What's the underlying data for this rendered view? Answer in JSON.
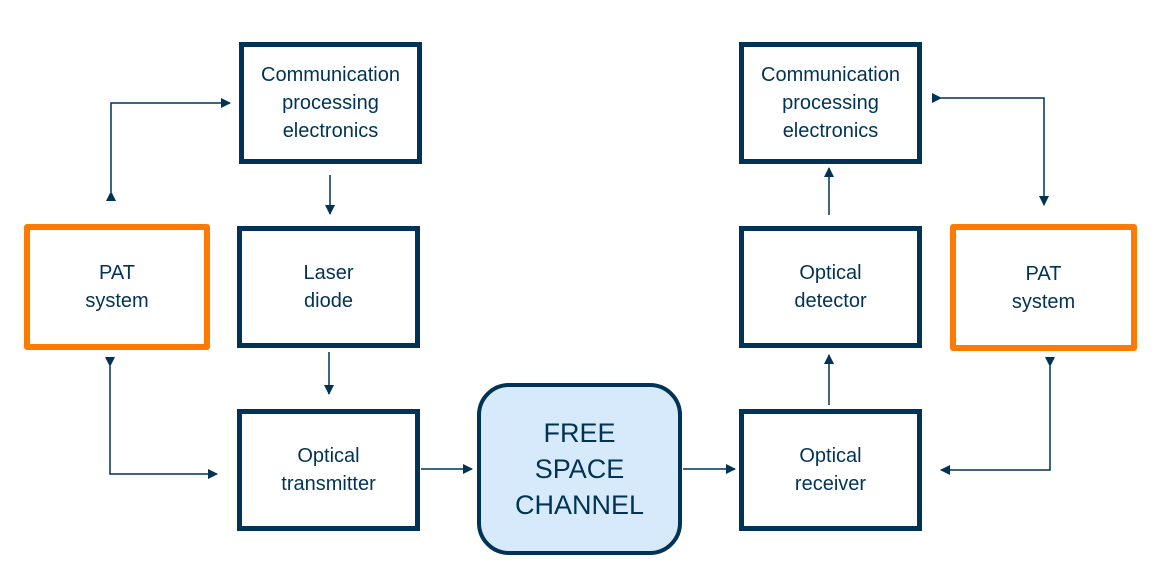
{
  "colors": {
    "primary": "#003355",
    "pat_border": "#ff7a00",
    "channel_fill": "#d6eafc"
  },
  "transmitter": {
    "comm": "Communication\nprocessing\nelectronics",
    "laser": "Laser\ndiode",
    "optical_tx": "Optical\ntransmitter",
    "pat": "PAT\nsystem"
  },
  "channel": "FREE\nSPACE\nCHANNEL",
  "receiver": {
    "comm": "Communication\nprocessing\nelectronics",
    "detector": "Optical\ndetector",
    "optical_rx": "Optical\nreceiver",
    "pat": "PAT\nsystem"
  }
}
